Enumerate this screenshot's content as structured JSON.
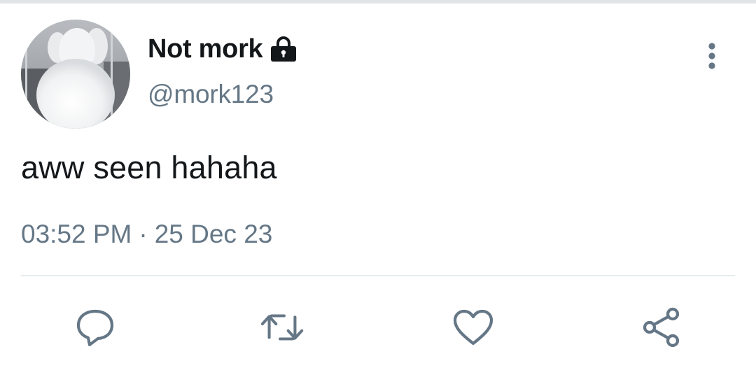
{
  "tweet": {
    "display_name": "Not mork",
    "handle": "@mork123",
    "text": "aww seen hahaha",
    "time": "03:52 PM",
    "separator": "·",
    "date": "25 Dec 23",
    "protected_icon": "lock-icon"
  },
  "header": {
    "more_icon": "more-vertical-icon"
  },
  "actions": [
    {
      "name": "reply",
      "icon": "reply-icon"
    },
    {
      "name": "retweet",
      "icon": "retweet-icon"
    },
    {
      "name": "like",
      "icon": "heart-icon"
    },
    {
      "name": "share",
      "icon": "share-icon"
    }
  ],
  "colors": {
    "text_primary": "#14171a",
    "text_secondary": "#657786",
    "icon_gray": "#657786",
    "divider": "#e6ecf0"
  }
}
